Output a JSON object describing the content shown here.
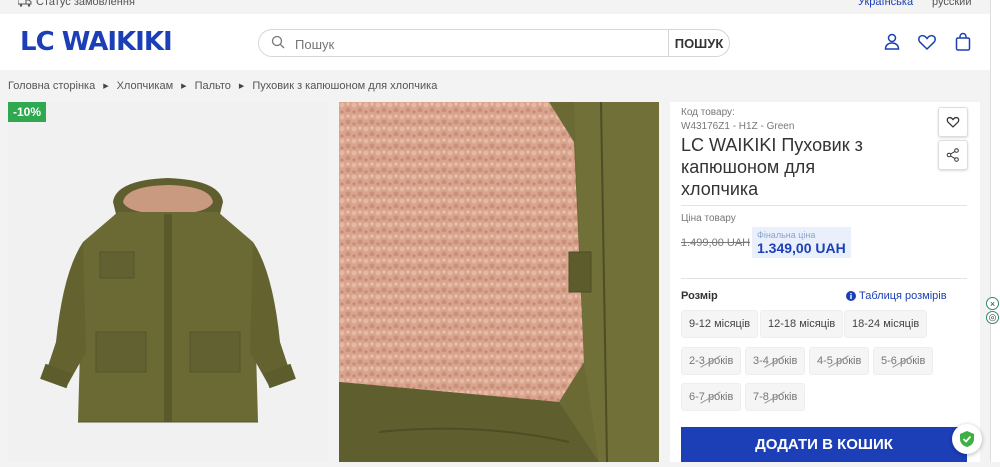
{
  "topbar": {
    "order_status": "Статус замовлення",
    "lang_ua": "Українська",
    "lang_ru": "русский"
  },
  "header": {
    "logo": "LC WAIKIKI",
    "search_placeholder": "Пошук",
    "search_button": "ПОШУК",
    "icons": [
      "user-icon",
      "heart-icon",
      "bag-icon"
    ]
  },
  "breadcrumbs": [
    "Головна сторінка",
    "Хлопчикам",
    "Пальто",
    "Пуховик з капюшоном для хлопчика"
  ],
  "gallery": {
    "discount_badge": "-10%"
  },
  "product": {
    "code_label": "Код товару:",
    "code_value": "W43176Z1 - H1Z - Green",
    "title": "LC WAIKIKI Пуховик з капюшоном для хлопчика",
    "price_label": "Ціна товару",
    "old_price": "1.499,00 UAH",
    "final_label": "Фінальна ціна",
    "final_price": "1.349,00 UAH",
    "size_label": "Розмір",
    "size_table": "Таблиця розмірів",
    "sizes": [
      {
        "label": "9-12 місяців",
        "available": true
      },
      {
        "label": "12-18 місяців",
        "available": true
      },
      {
        "label": "18-24 місяців",
        "available": true
      },
      {
        "label": "2-3 років",
        "available": false
      },
      {
        "label": "3-4 років",
        "available": false
      },
      {
        "label": "4-5 років",
        "available": false
      },
      {
        "label": "5-6 років",
        "available": false
      },
      {
        "label": "6-7 років",
        "available": false
      },
      {
        "label": "7-8 років",
        "available": false
      }
    ],
    "add_to_cart": "ДОДАТИ В КОШИК"
  },
  "colors": {
    "brand_blue": "#1c3fb7",
    "discount_green": "#2fa84f",
    "coat_olive": "#6b6a35",
    "fur_pink": "#d9a48e"
  }
}
